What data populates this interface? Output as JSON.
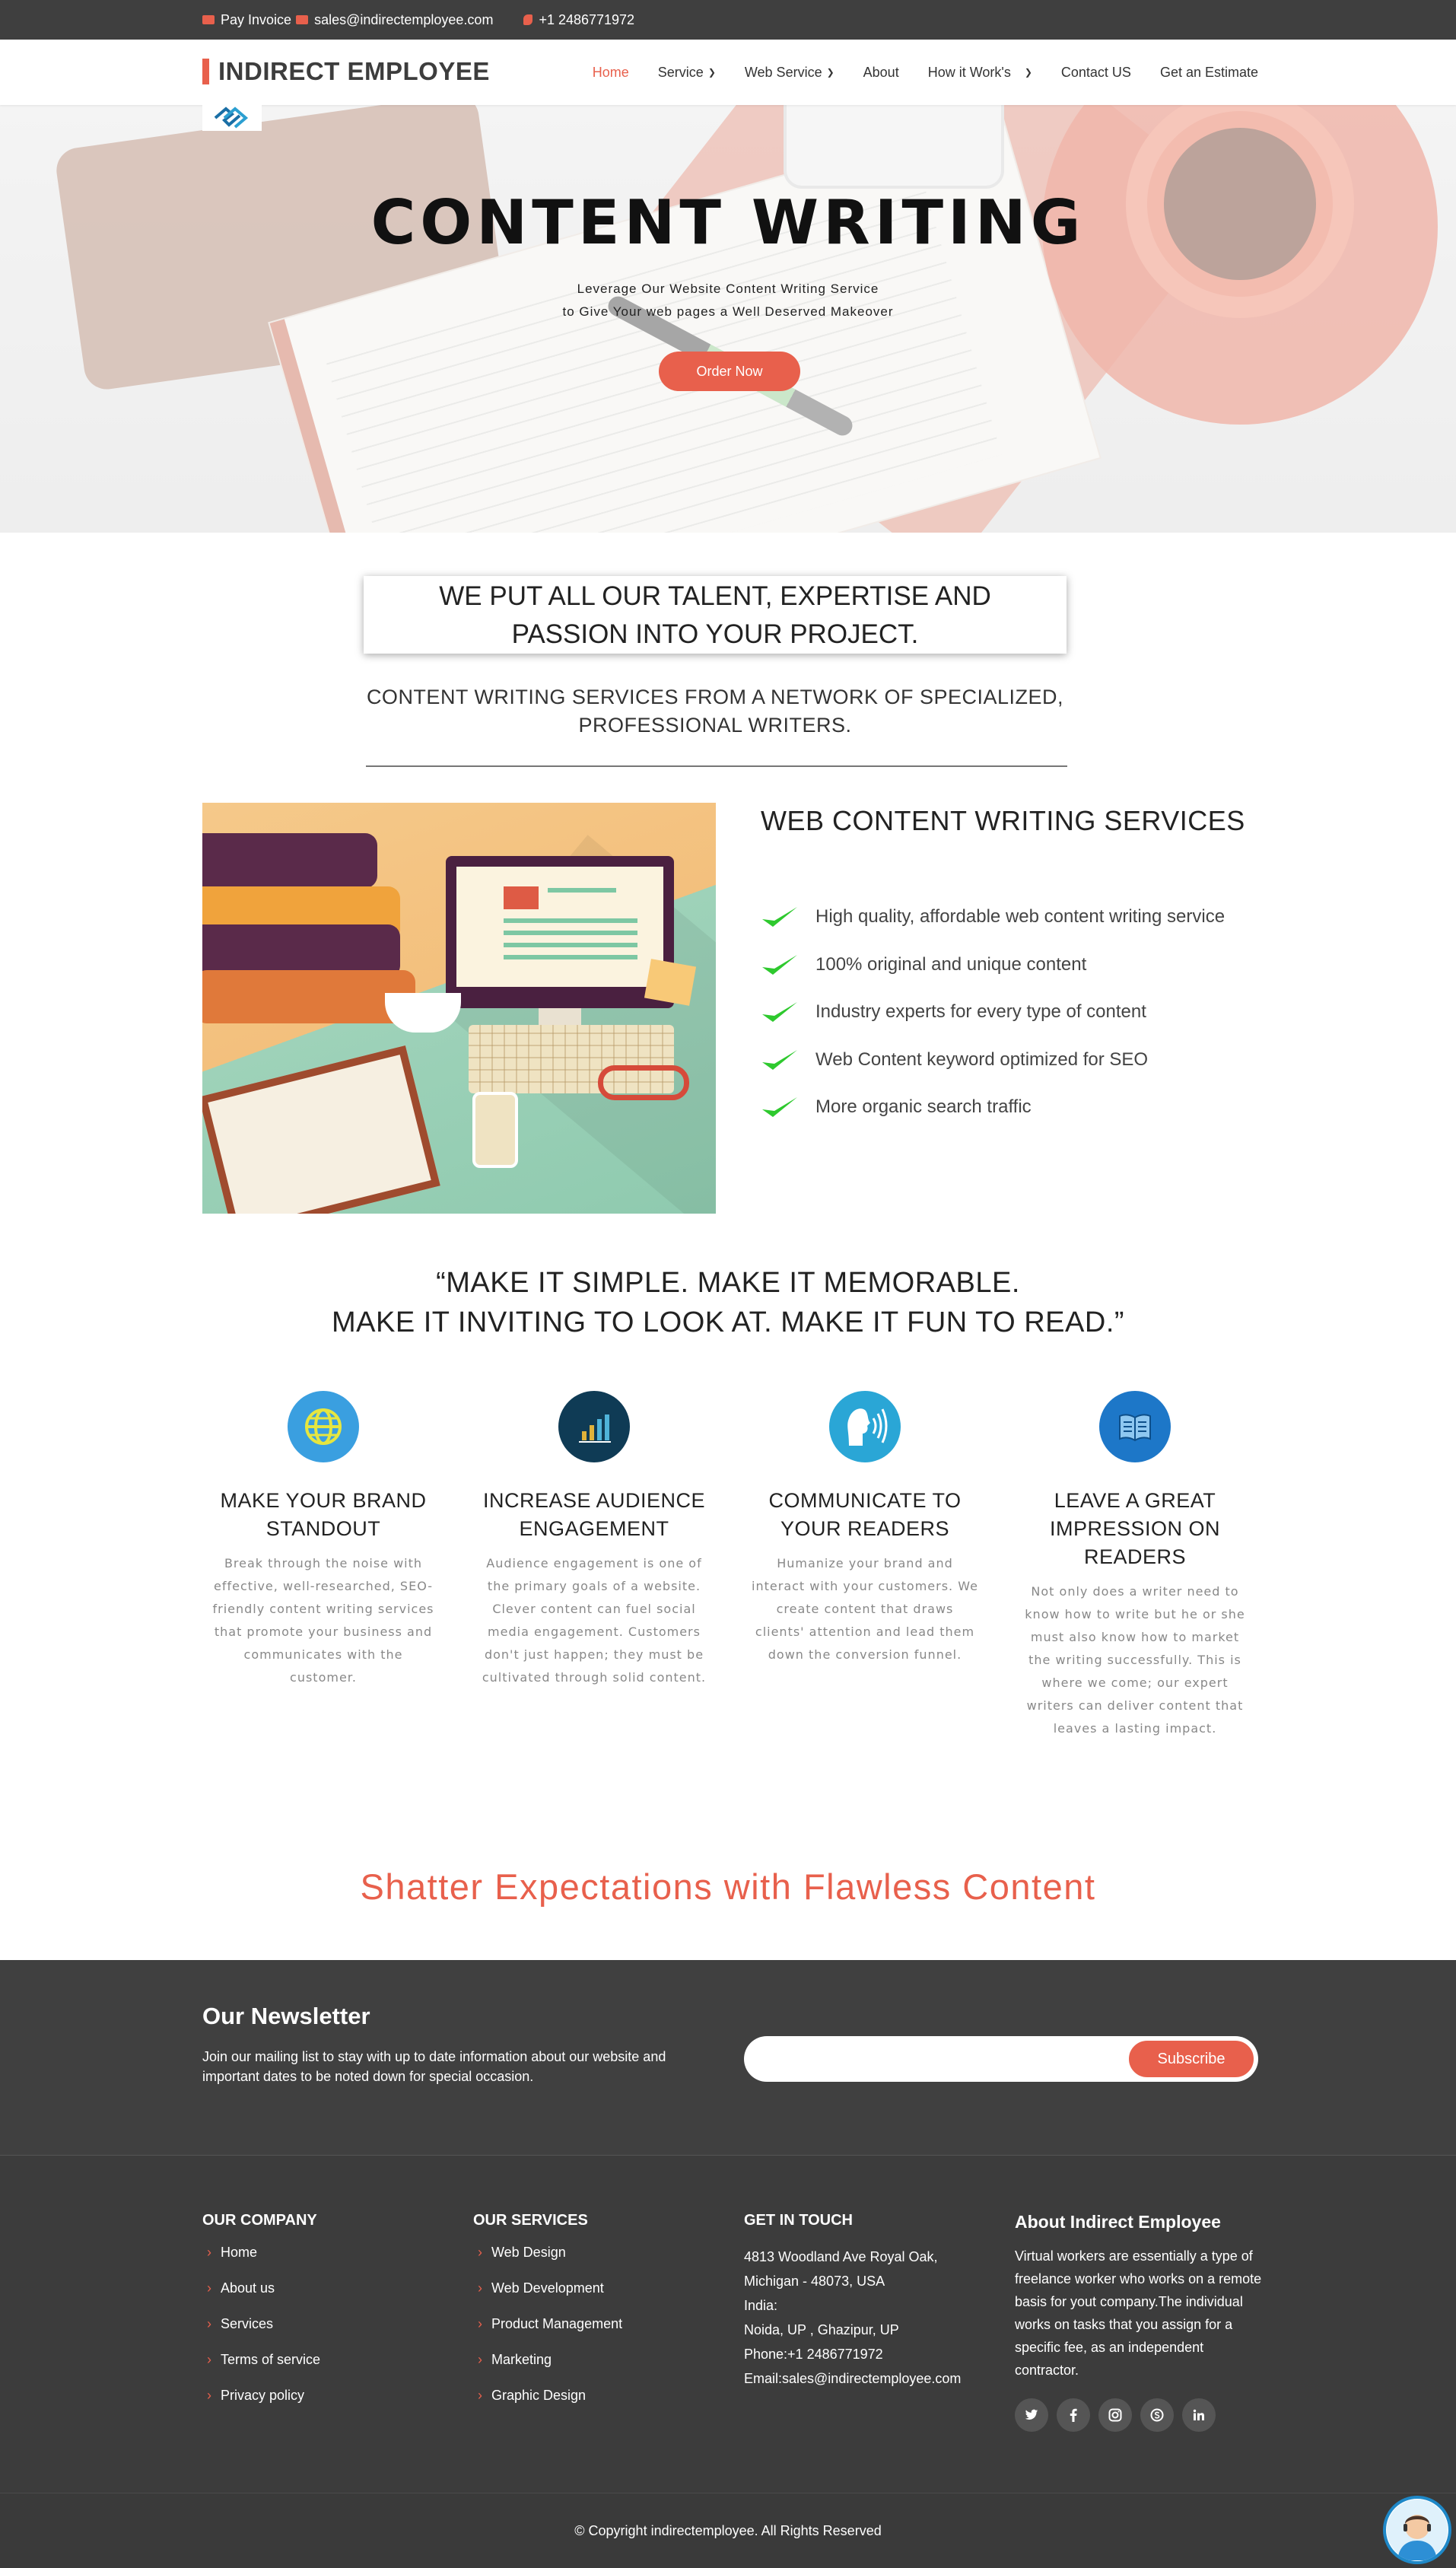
{
  "topbar": {
    "invoice": "Pay Invoice",
    "email": "sales@indirectemployee.com",
    "phone": "+1 2486771972"
  },
  "header": {
    "brand": "INDIRECT EMPLOYEE",
    "nav": [
      {
        "label": "Home",
        "active": true
      },
      {
        "label": "Service",
        "dropdown": true
      },
      {
        "label": "Web Service",
        "dropdown": true
      },
      {
        "label": "About"
      },
      {
        "label": "How it Work's",
        "dropdown": true
      },
      {
        "label": "Contact US"
      },
      {
        "label": "Get an Estimate"
      }
    ]
  },
  "hero": {
    "title": "CONTENT WRITING",
    "subtitle_1": "Leverage Our Website Content Writing Service",
    "subtitle_2": "to Give Your web pages a Well Deserved Makeover",
    "cta": "Order Now"
  },
  "intro": {
    "heading_1": "WE PUT ALL OUR TALENT, EXPERTISE AND",
    "heading_2": "PASSION INTO YOUR PROJECT.",
    "sub_1": "CONTENT WRITING SERVICES FROM A NETWORK OF SPECIALIZED,",
    "sub_2": "PROFESSIONAL WRITERS."
  },
  "services": {
    "title": "WEB CONTENT WRITING SERVICES",
    "items": [
      "High quality, affordable web content writing service",
      "100% original and unique content",
      "Industry experts for every type of content",
      "Web Content keyword optimized for SEO",
      "More organic search traffic"
    ]
  },
  "quote": {
    "line_1": "“MAKE IT SIMPLE. MAKE IT MEMORABLE.",
    "line_2": "MAKE IT INVITING TO LOOK AT. MAKE IT FUN TO READ.”"
  },
  "features": [
    {
      "icon": "globe-icon",
      "color": "#3a9fe0",
      "title": "MAKE YOUR BRAND STANDOUT",
      "text": "Break through the noise with effective, well-researched, SEO-friendly content writing services that promote your business and communicates with the customer."
    },
    {
      "icon": "chart-icon",
      "color": "#0f3b55",
      "title": "INCREASE AUDIENCE ENGAGEMENT",
      "text": "Audience engagement is one of the primary goals of a website. Clever content can fuel social media engagement. Customers don't just happen; they must be cultivated through solid content."
    },
    {
      "icon": "speaking-head-icon",
      "color": "#2aa6d6",
      "title": "COMMUNICATE TO YOUR READERS",
      "text": "Humanize your brand and interact with your customers. We create content that draws clients' attention and lead them down the conversion funnel."
    },
    {
      "icon": "book-icon",
      "color": "#1d77c8",
      "title": "LEAVE A GREAT IMPRESSION ON READERS",
      "text": "Not only does a writer need to know how to write but he or she must also know how to market the writing successfully. This is where we come; our expert writers can deliver content that leaves a lasting impact."
    }
  ],
  "tagline": "Shatter Expectations with Flawless Content",
  "newsletter": {
    "title": "Our Newsletter",
    "text": "Join our mailing list to stay with up to date information about our website and important dates to be noted down for special occasion.",
    "input_value": "",
    "button": "Subscribe"
  },
  "footer": {
    "company": {
      "title": "OUR COMPANY",
      "links": [
        "Home",
        "About us",
        "Services",
        "Terms of service",
        "Privacy policy"
      ]
    },
    "services": {
      "title": "OUR SERVICES",
      "links": [
        "Web Design",
        "Web Development",
        "Product Management",
        "Marketing",
        "Graphic Design"
      ]
    },
    "contact": {
      "title": "GET IN TOUCH",
      "lines": [
        "4813 Woodland Ave Royal Oak,",
        "Michigan - 48073, USA",
        "India:",
        "Noida, UP , Ghazipur, UP",
        "Phone:+1 2486771972",
        "Email:sales@indirectemployee.com"
      ]
    },
    "about": {
      "title": "About Indirect Employee",
      "text": "Virtual workers are essentially a type of freelance worker who works on a remote basis for yout company.The individual works on tasks that you assign for a specific fee, as an independent contractor."
    },
    "social": [
      "twitter-icon",
      "facebook-icon",
      "instagram-icon",
      "skype-icon",
      "linkedin-icon"
    ]
  },
  "copyright": "© Copyright indirectemployee. All Rights Reserved",
  "colors": {
    "accent": "#e8604c",
    "dark": "#3f3f3f"
  }
}
